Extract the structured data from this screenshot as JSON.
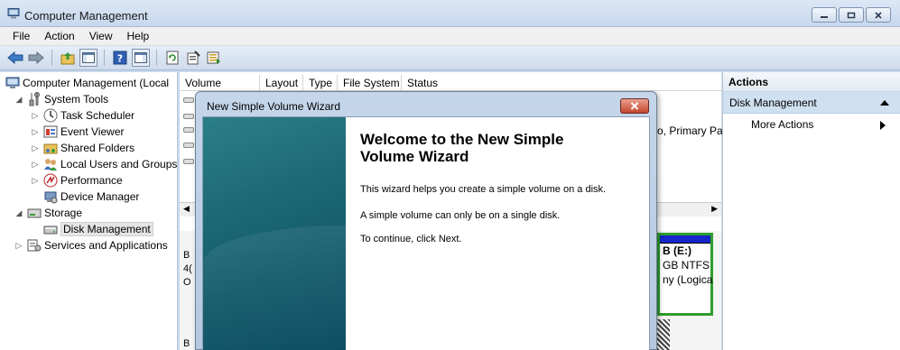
{
  "window": {
    "title": "Computer Management",
    "minimize_icon": "minimize-icon",
    "maximize_icon": "restore-icon",
    "close_icon": "close-icon"
  },
  "menu": [
    "File",
    "Action",
    "View",
    "Help"
  ],
  "toolbar": {
    "buttons": [
      "back-icon",
      "forward-icon",
      "up-folder-icon",
      "show-hide-tree-icon",
      "help-icon",
      "show-hide-action-pane-icon",
      "refresh-icon",
      "properties-icon",
      "export-list-icon"
    ]
  },
  "tree": {
    "root": "Computer Management (Local",
    "system_tools": "System Tools",
    "task_scheduler": "Task Scheduler",
    "event_viewer": "Event Viewer",
    "shared_folders": "Shared Folders",
    "local_users": "Local Users and Groups",
    "performance": "Performance",
    "device_manager": "Device Manager",
    "storage": "Storage",
    "disk_management": "Disk Management",
    "services": "Services and Applications"
  },
  "volume_list": {
    "columns": [
      "Volume",
      "Layout",
      "Type",
      "File System",
      "Status"
    ],
    "partial_status": "o, Primary Pa"
  },
  "disk_area": {
    "disk0_letters": [
      "B",
      "4(",
      "O"
    ],
    "disk1_letter": "B",
    "volume_label": "B  (E:)",
    "volume_size": "GB NTFS",
    "volume_status": "ny (Logica"
  },
  "actions": {
    "header": "Actions",
    "section": "Disk Management",
    "more": "More Actions"
  },
  "wizard": {
    "title": "New Simple Volume Wizard",
    "heading": "Welcome to the New Simple Volume Wizard",
    "line1": "This wizard helps you create a simple volume on a disk.",
    "line2": "A simple volume can only be on a single disk.",
    "line3": "To continue, click Next."
  },
  "colors": {
    "volume_header": "#1426c9",
    "volume_border": "#2e9e2e",
    "wizard_side": "#1d6a76"
  }
}
